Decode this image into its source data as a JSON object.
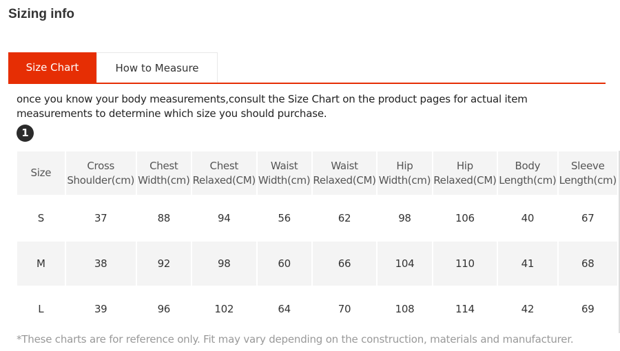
{
  "title": "Sizing info",
  "tabs": [
    {
      "label": "Size Chart",
      "active": true
    },
    {
      "label": "How to Measure",
      "active": false
    }
  ],
  "accent_color": "#e62e04",
  "description": "once you know your body measurements,consult the Size Chart on the product pages for actual item measurements to determine which size you should purchase.",
  "badge": "1",
  "table": {
    "headers": [
      [
        "Size",
        ""
      ],
      [
        "Cross",
        "Shoulder(cm)"
      ],
      [
        "Chest",
        "Width(cm)"
      ],
      [
        "Chest",
        "Relaxed(CM)"
      ],
      [
        "Waist",
        "Width(cm)"
      ],
      [
        "Waist",
        "Relaxed(CM)"
      ],
      [
        "Hip",
        "Width(cm)"
      ],
      [
        "Hip",
        "Relaxed(CM)"
      ],
      [
        "Body",
        "Length(cm)"
      ],
      [
        "Sleeve",
        "Length(cm)"
      ]
    ],
    "rows": [
      [
        "S",
        "37",
        "88",
        "94",
        "56",
        "62",
        "98",
        "106",
        "40",
        "67"
      ],
      [
        "M",
        "38",
        "92",
        "98",
        "60",
        "66",
        "104",
        "110",
        "41",
        "68"
      ],
      [
        "L",
        "39",
        "96",
        "102",
        "64",
        "70",
        "108",
        "114",
        "42",
        "69"
      ]
    ]
  },
  "note": "*These charts are for reference only. Fit may vary depending on the construction, materials and manufacturer."
}
